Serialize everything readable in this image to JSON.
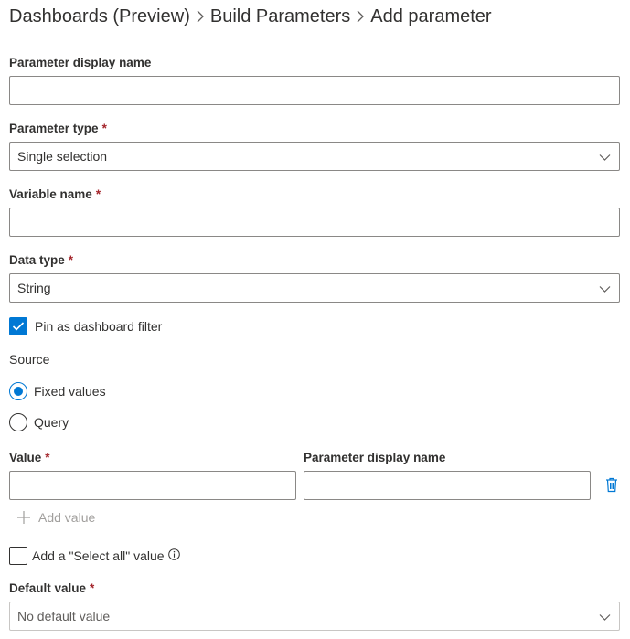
{
  "breadcrumb": {
    "items": [
      "Dashboards (Preview)",
      "Build Parameters",
      "Add parameter"
    ]
  },
  "form": {
    "display_name": {
      "label": "Parameter display name",
      "value": ""
    },
    "parameter_type": {
      "label": "Parameter type",
      "required": "*",
      "value": "Single selection"
    },
    "variable_name": {
      "label": "Variable name",
      "required": "*",
      "value": ""
    },
    "data_type": {
      "label": "Data type",
      "required": "*",
      "value": "String"
    },
    "pin_filter": {
      "label": "Pin as dashboard filter",
      "checked": true
    },
    "source": {
      "label": "Source",
      "options": [
        {
          "label": "Fixed values",
          "selected": true
        },
        {
          "label": "Query",
          "selected": false
        }
      ]
    },
    "values_table": {
      "value_header": "Value",
      "value_required": "*",
      "display_header": "Parameter display name",
      "rows": [
        {
          "value": "",
          "display_name": ""
        }
      ]
    },
    "add_value_label": "Add value",
    "select_all": {
      "label": "Add a \"Select all\" value",
      "checked": false
    },
    "default_value": {
      "label": "Default value",
      "required": "*",
      "value": "No default value"
    }
  },
  "colors": {
    "accent": "#0078d4",
    "required": "#a4262c",
    "disabled_text": "#a19f9d"
  },
  "icons": [
    "chevron-right-icon",
    "chevron-down-icon",
    "checkmark-icon",
    "plus-icon",
    "delete-icon",
    "info-icon"
  ]
}
